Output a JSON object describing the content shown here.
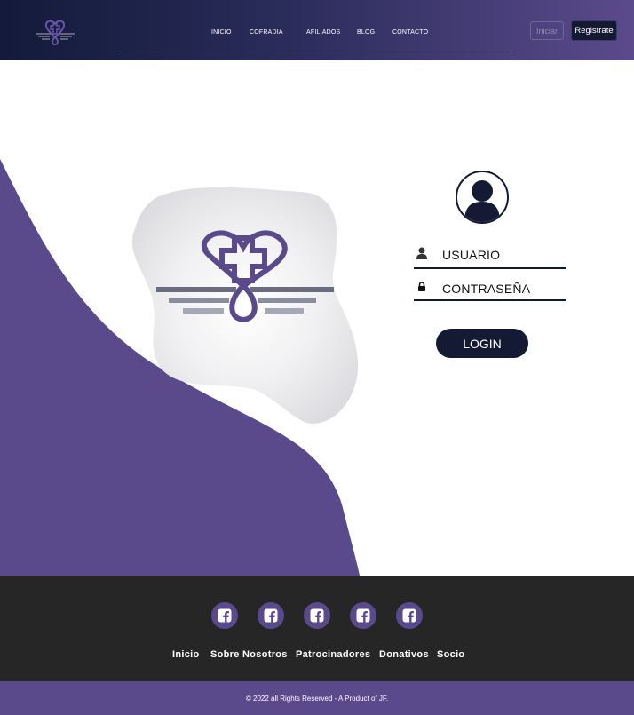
{
  "nav": {
    "links": [
      "INICIO",
      "COFRADIA",
      "AFILIADOS",
      "BLOG",
      "CONTACTO"
    ],
    "login_button": "Iniciar",
    "register_button": "Registrate"
  },
  "login": {
    "username_label": "USUARIO",
    "password_label": "CONTRASEÑA",
    "submit_label": "LOGIN"
  },
  "footer": {
    "social_icons": [
      "facebook-icon",
      "facebook-icon",
      "facebook-icon",
      "facebook-icon",
      "facebook-icon"
    ],
    "links": [
      "Inicio",
      "Sobre Nosotros",
      "Patrocinadores",
      "Donativos",
      "Socio"
    ],
    "copyright": "© 2022 all Rights Reserved - A Product of JF."
  },
  "colors": {
    "brand_purple": "#5a4a8c",
    "navy": "#141a33",
    "footer_dark": "#262626"
  }
}
